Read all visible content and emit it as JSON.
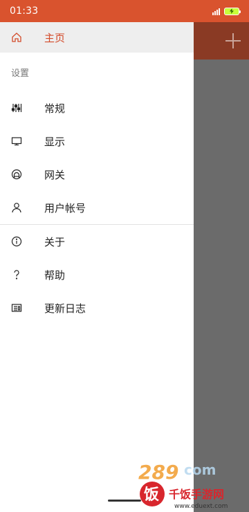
{
  "status": {
    "time": "01:33"
  },
  "drawer": {
    "home": {
      "label": "主页",
      "icon": "home-icon"
    },
    "section_title": "设置",
    "items": [
      {
        "label": "常规",
        "icon": "sliders-icon"
      },
      {
        "label": "显示",
        "icon": "monitor-icon"
      },
      {
        "label": "网关",
        "icon": "gateway-icon"
      },
      {
        "label": "用户帐号",
        "icon": "user-icon"
      },
      {
        "label": "关于",
        "icon": "info-icon"
      },
      {
        "label": "帮助",
        "icon": "help-icon"
      },
      {
        "label": "更新日志",
        "icon": "changelog-icon"
      }
    ]
  },
  "colors": {
    "accent": "#d34a29",
    "status_bar": "#d9532e",
    "scrim": "#6b6b6b"
  }
}
